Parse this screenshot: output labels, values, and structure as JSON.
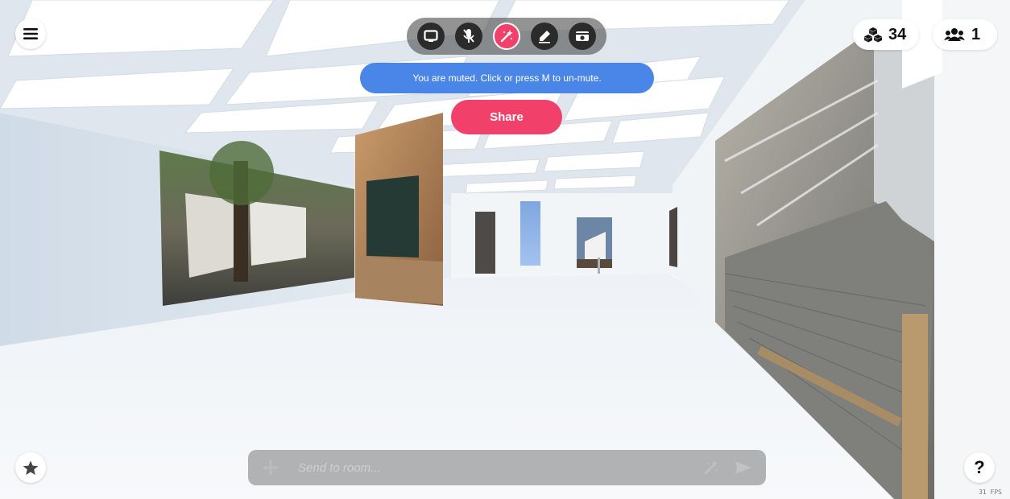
{
  "toolbar": {
    "tools": [
      {
        "name": "screen-share",
        "icon": "screen-icon"
      },
      {
        "name": "microphone",
        "icon": "mic-off-icon"
      },
      {
        "name": "spawn-object",
        "icon": "magic-wand-icon",
        "active": true
      },
      {
        "name": "pen",
        "icon": "pen-icon"
      },
      {
        "name": "camera",
        "icon": "camera-icon"
      }
    ]
  },
  "mute_banner": "You are muted. Click or press M to un-mute.",
  "share_label": "Share",
  "objects_count": "34",
  "users_count": "1",
  "chat": {
    "placeholder": "Send to room..."
  },
  "help_label": "?",
  "fps": "31 FPS",
  "colors": {
    "accent": "#f1416a",
    "banner": "#4a86e8"
  }
}
